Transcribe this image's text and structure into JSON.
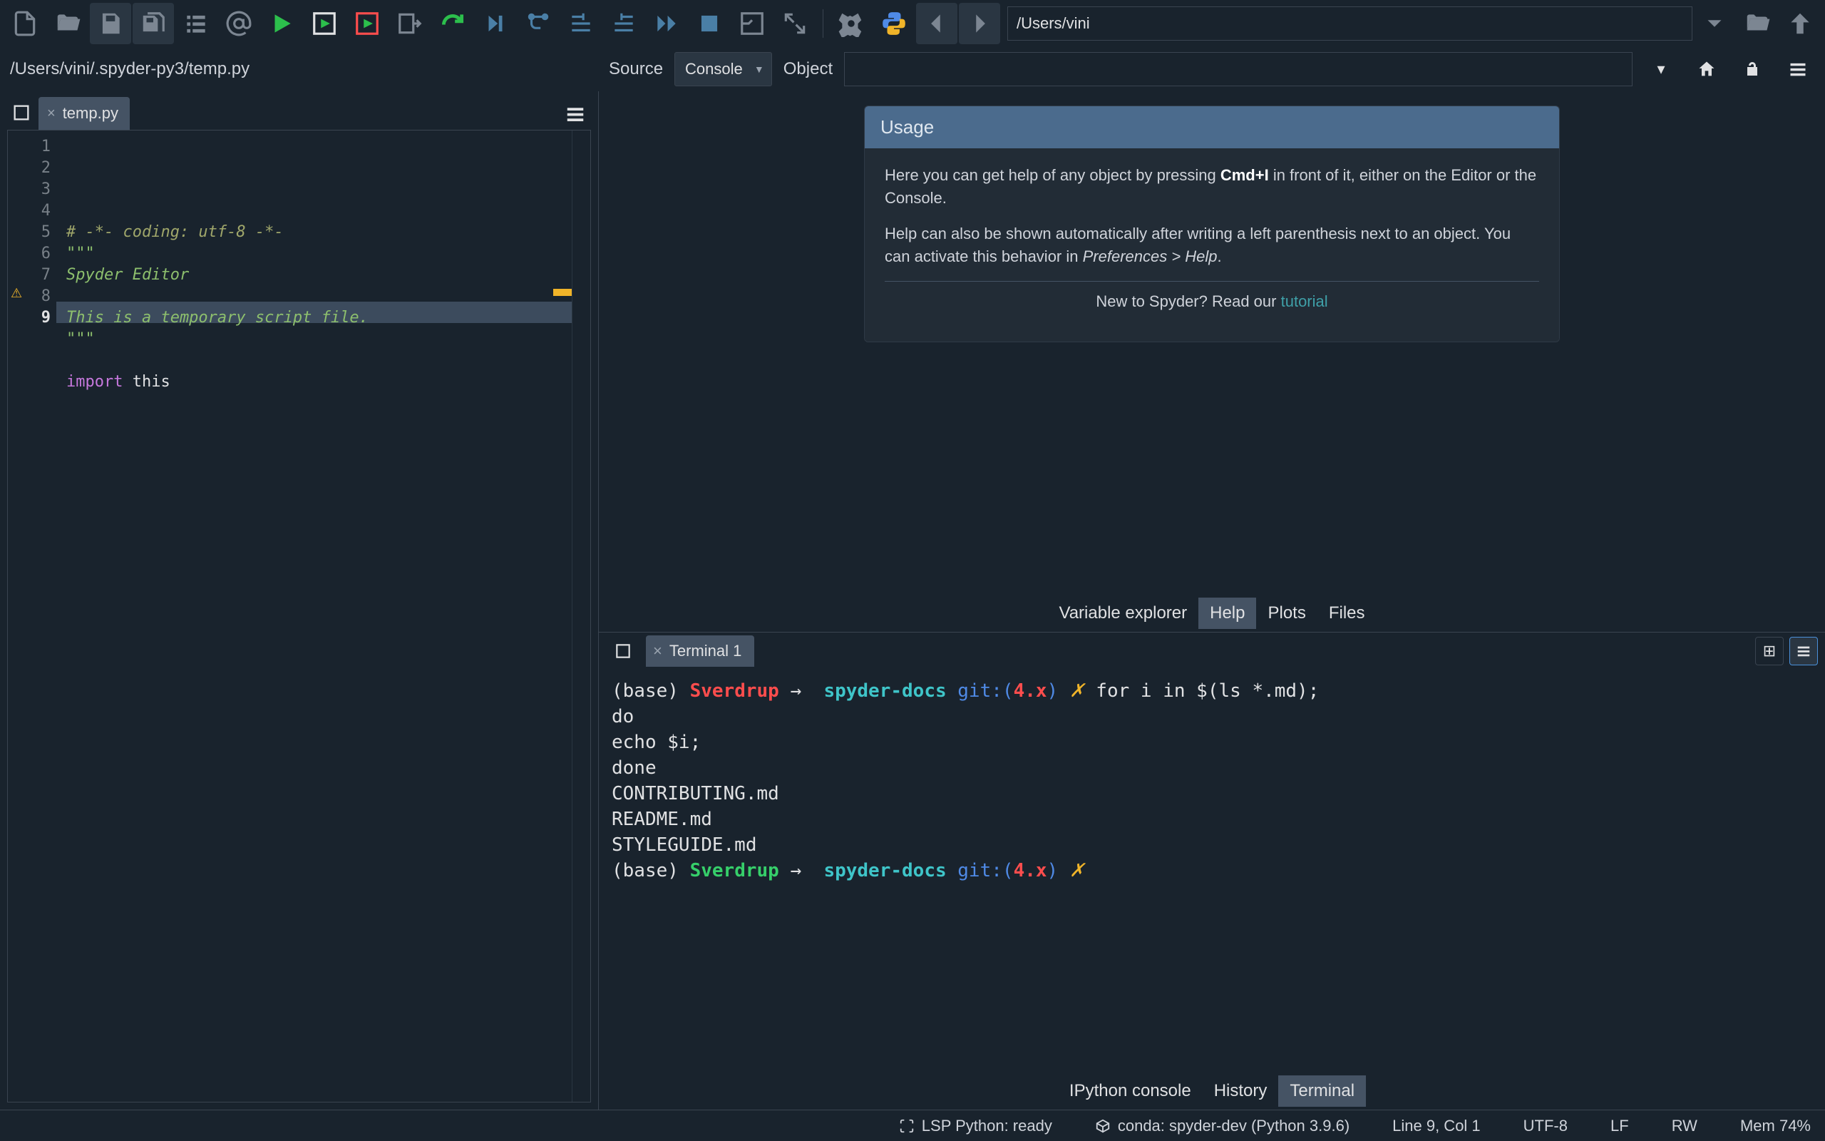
{
  "toolbar": {
    "workdir": "/Users/vini"
  },
  "editor": {
    "path": "/Users/vini/.spyder-py3/temp.py",
    "tab_name": "temp.py",
    "line_numbers": [
      "1",
      "2",
      "3",
      "4",
      "5",
      "6",
      "7",
      "8",
      "9"
    ],
    "code": {
      "l1": "# -*- coding: utf-8 -*-",
      "l2": "\"\"\"",
      "l3": "Spyder Editor",
      "l4": "",
      "l5": "This is a temporary script file.",
      "l6": "\"\"\"",
      "l7": "",
      "l8_kw": "import",
      "l8_rest": " this",
      "l9": ""
    },
    "warning_line": 8
  },
  "help": {
    "source_label": "Source",
    "source_value": "Console",
    "object_label": "Object",
    "box_title": "Usage",
    "p1a": "Here you can get help of any object by pressing ",
    "p1kbd": "Cmd+I",
    "p1b": " in front of it, either on the Editor or the Console.",
    "p2a": "Help can also be shown automatically after writing a left parenthesis next to an object. You can activate this behavior in ",
    "p2pref": "Preferences > Help",
    "p2b": ".",
    "footer_a": "New to Spyder? Read our ",
    "footer_link": "tutorial",
    "tabs": {
      "varexp": "Variable explorer",
      "help": "Help",
      "plots": "Plots",
      "files": "Files"
    }
  },
  "terminal": {
    "tab_name": "Terminal 1",
    "prompt": {
      "base": "(base)",
      "host": "Sverdrup",
      "arrow": "→",
      "dir": "spyder-docs",
      "gitpre": "git:(",
      "branch": "4.x",
      "gitpost": ")",
      "dirty": "✗"
    },
    "cmd1": "for i in $(ls *.md);",
    "cont": [
      "do",
      "echo $i;",
      "done"
    ],
    "out": [
      "CONTRIBUTING.md",
      "README.md",
      "STYLEGUIDE.md"
    ],
    "tabs": {
      "ipython": "IPython console",
      "history": "History",
      "terminal": "Terminal"
    }
  },
  "status": {
    "lsp": "LSP Python: ready",
    "conda": "conda: spyder-dev (Python 3.9.6)",
    "linecol": "Line 9, Col 1",
    "encoding": "UTF-8",
    "eol": "LF",
    "rw": "RW",
    "mem": "Mem 74%"
  }
}
